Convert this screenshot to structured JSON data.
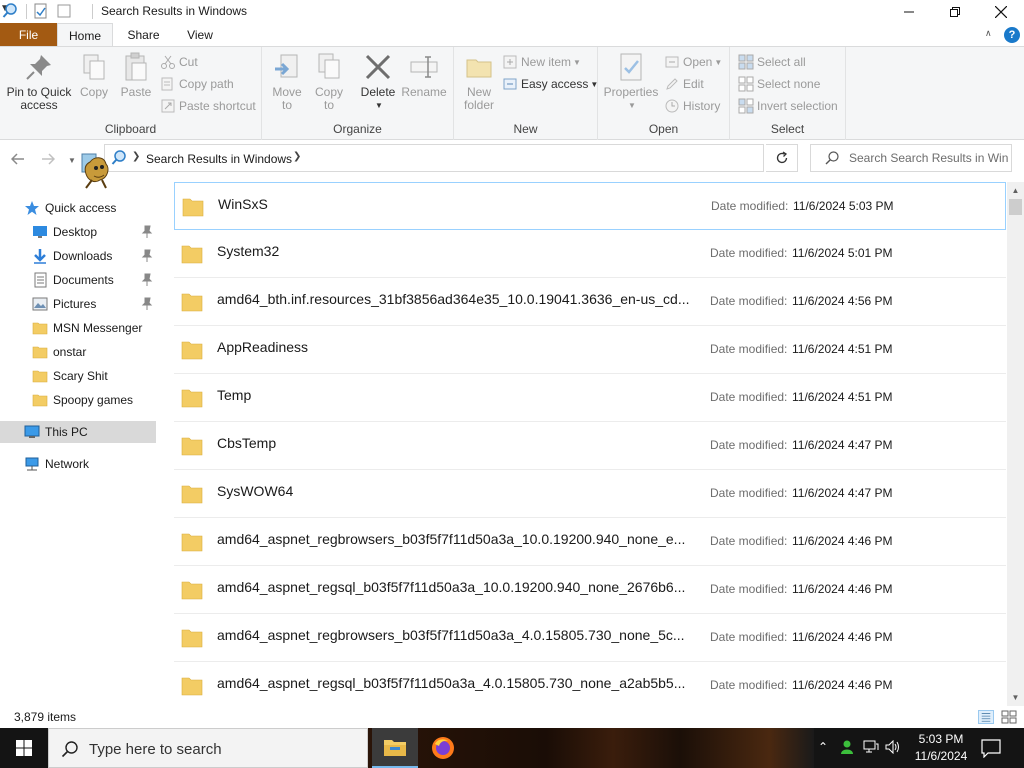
{
  "window": {
    "title": "Search Results in Windows",
    "minimize_icon": "minimize-icon",
    "maximize_icon": "maximize-icon",
    "close_icon": "close-icon"
  },
  "ribbon": {
    "tabs": [
      {
        "label": "File"
      },
      {
        "label": "Home"
      },
      {
        "label": "Share"
      },
      {
        "label": "View"
      }
    ],
    "clipboard": {
      "label": "Clipboard",
      "pin_label_1": "Pin to Quick",
      "pin_label_2": "access",
      "copy_label": "Copy",
      "paste_label": "Paste",
      "cut_label": "Cut",
      "copy_path_label": "Copy path",
      "paste_shortcut_label": "Paste shortcut"
    },
    "organize": {
      "label": "Organize",
      "move_label_1": "Move",
      "move_label_2": "to",
      "copy_label_1": "Copy",
      "copy_label_2": "to",
      "delete_label": "Delete",
      "rename_label": "Rename"
    },
    "new": {
      "label": "New",
      "new_folder_1": "New",
      "new_folder_2": "folder",
      "new_item_label": "New item",
      "easy_access_label": "Easy access"
    },
    "open": {
      "label": "Open",
      "properties_label": "Properties",
      "open_label": "Open",
      "edit_label": "Edit",
      "history_label": "History"
    },
    "select": {
      "label": "Select",
      "select_all_label": "Select all",
      "select_none_label": "Select none",
      "invert_label": "Invert selection"
    }
  },
  "address": {
    "path": "Search Results in Windows",
    "search_placeholder": "Search Search Results in Win..."
  },
  "nav": {
    "quick_access": "Quick access",
    "items": [
      {
        "label": "Desktop",
        "icon": "desktop-icon",
        "pinned": true
      },
      {
        "label": "Downloads",
        "icon": "downloads-icon",
        "pinned": true
      },
      {
        "label": "Documents",
        "icon": "documents-icon",
        "pinned": true
      },
      {
        "label": "Pictures",
        "icon": "pictures-icon",
        "pinned": true
      },
      {
        "label": "MSN Messenger",
        "icon": "folder-icon",
        "pinned": false
      },
      {
        "label": "onstar",
        "icon": "folder-icon",
        "pinned": false
      },
      {
        "label": "Scary Shit",
        "icon": "folder-icon",
        "pinned": false
      },
      {
        "label": "Spoopy games",
        "icon": "folder-icon",
        "pinned": false
      }
    ],
    "this_pc": "This PC",
    "network": "Network"
  },
  "files": {
    "date_label": "Date modified:",
    "rows": [
      {
        "name": "WinSxS",
        "date": "11/6/2024 5:03 PM",
        "selected": true
      },
      {
        "name": "System32",
        "date": "11/6/2024 5:01 PM",
        "selected": false
      },
      {
        "name": "amd64_bth.inf.resources_31bf3856ad364e35_10.0.19041.3636_en-us_cd...",
        "date": "11/6/2024 4:56 PM",
        "selected": false
      },
      {
        "name": "AppReadiness",
        "date": "11/6/2024 4:51 PM",
        "selected": false
      },
      {
        "name": "Temp",
        "date": "11/6/2024 4:51 PM",
        "selected": false
      },
      {
        "name": "CbsTemp",
        "date": "11/6/2024 4:47 PM",
        "selected": false
      },
      {
        "name": "SysWOW64",
        "date": "11/6/2024 4:47 PM",
        "selected": false
      },
      {
        "name": "amd64_aspnet_regbrowsers_b03f5f7f11d50a3a_10.0.19200.940_none_e...",
        "date": "11/6/2024 4:46 PM",
        "selected": false
      },
      {
        "name": "amd64_aspnet_regsql_b03f5f7f11d50a3a_10.0.19200.940_none_2676b6...",
        "date": "11/6/2024 4:46 PM",
        "selected": false
      },
      {
        "name": "amd64_aspnet_regbrowsers_b03f5f7f11d50a3a_4.0.15805.730_none_5c...",
        "date": "11/6/2024 4:46 PM",
        "selected": false
      },
      {
        "name": "amd64_aspnet_regsql_b03f5f7f11d50a3a_4.0.15805.730_none_a2ab5b5...",
        "date": "11/6/2024 4:46 PM",
        "selected": false
      }
    ]
  },
  "status": {
    "item_count": "3,879 items"
  },
  "taskbar": {
    "search_placeholder": "Type here to search",
    "time": "5:03 PM",
    "date": "11/6/2024"
  },
  "colors": {
    "file_tab": "#a35a12",
    "selection_border": "#99d1ff",
    "folder": "#f3cc64",
    "taskbar": "#141414"
  }
}
